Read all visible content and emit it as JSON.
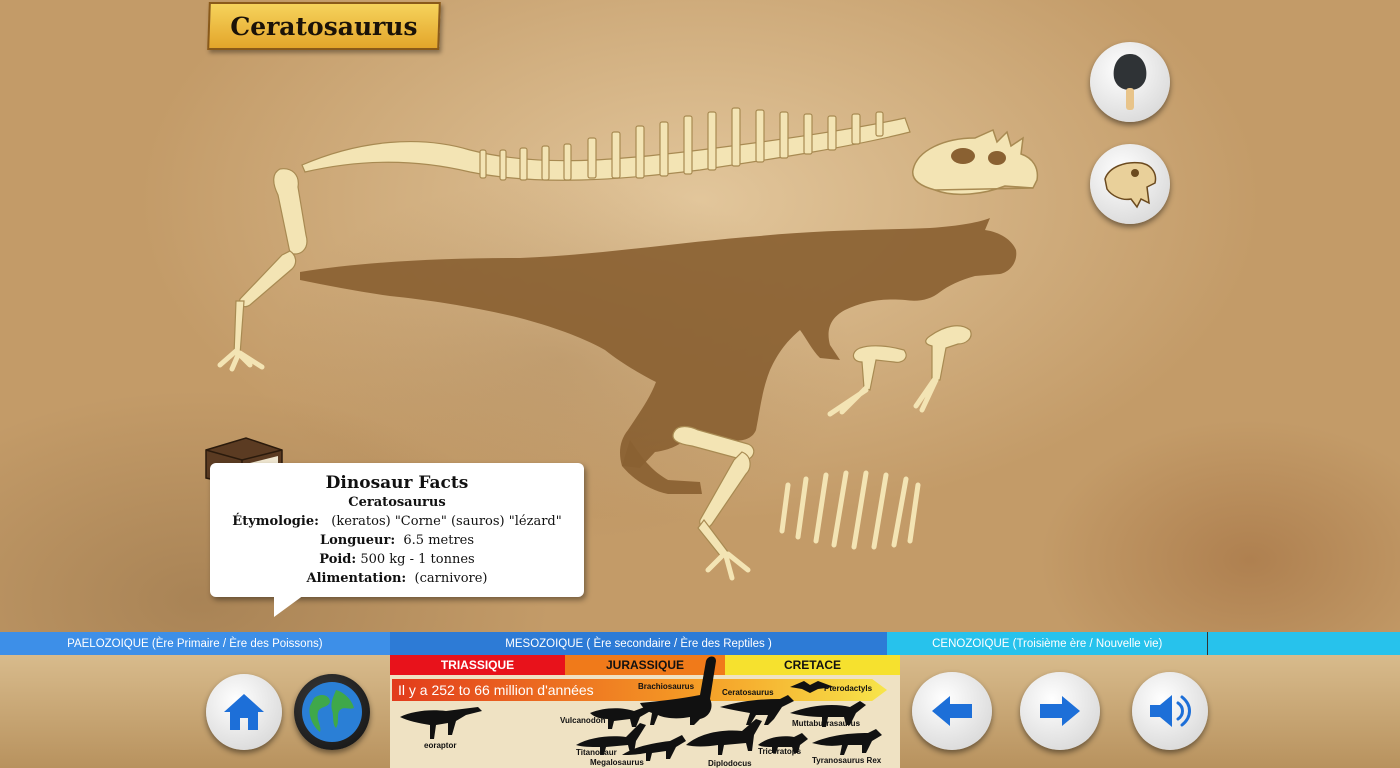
{
  "title": "Ceratosaurus",
  "facts": {
    "heading": "Dinosaur Facts",
    "name": "Ceratosaurus",
    "etymology_label": "Étymologie:",
    "etymology_value": "(keratos) \"Corne\" (sauros) \"lézard\"",
    "length_label": "Longueur:",
    "length_value": "6.5 metres",
    "weight_label": "Poid:",
    "weight_value": "500 kg - 1 tonnes",
    "diet_label": "Alimentation:",
    "diet_value": "(carnivore)"
  },
  "timeline": {
    "paleozoic": "PAELOZOIQUE   (Ère Primaire / Ère des Poissons)",
    "mesozoic": "MESOZOIQUE    ( Ère secondaire / Ère des Reptiles )",
    "cenozoic": "CENOZOIQUE  (Troisième ère / Nouvelle vie)"
  },
  "periods": {
    "triassic": "TRIASSIQUE",
    "jurassic": "JURASSIQUE",
    "cretaceous": "CRETACE"
  },
  "years_ago": "Il y a 252 to 66 million d'années",
  "dinosaurs": [
    "Brachiosaurus",
    "Ceratosaurus",
    "Pterodactyls",
    "Vulcanodon",
    "Muttaburrasaurus",
    "eoraptor",
    "Titanosaur",
    "Megalosaurus",
    "Diplodocus",
    "Triceratops",
    "Tyranosaurus Rex"
  ],
  "icons": {
    "shovel": "shovel-icon",
    "skull": "dino-skull-icon",
    "book": "book-icon",
    "home": "home-icon",
    "globe": "globe-icon",
    "prev": "arrow-left-icon",
    "next": "arrow-right-icon",
    "sound": "speaker-icon"
  },
  "colors": {
    "bone": "#f3e4b4",
    "silhouette": "#8a6132",
    "paleozoic": "#3d8fe8",
    "mesozoic": "#2d7bd6",
    "cenozoic": "#27c2ec",
    "triassic": "#e8121b",
    "jurassic": "#f07a1a",
    "cretaceous": "#f6e12e",
    "button_blue": "#1d6fd8"
  }
}
